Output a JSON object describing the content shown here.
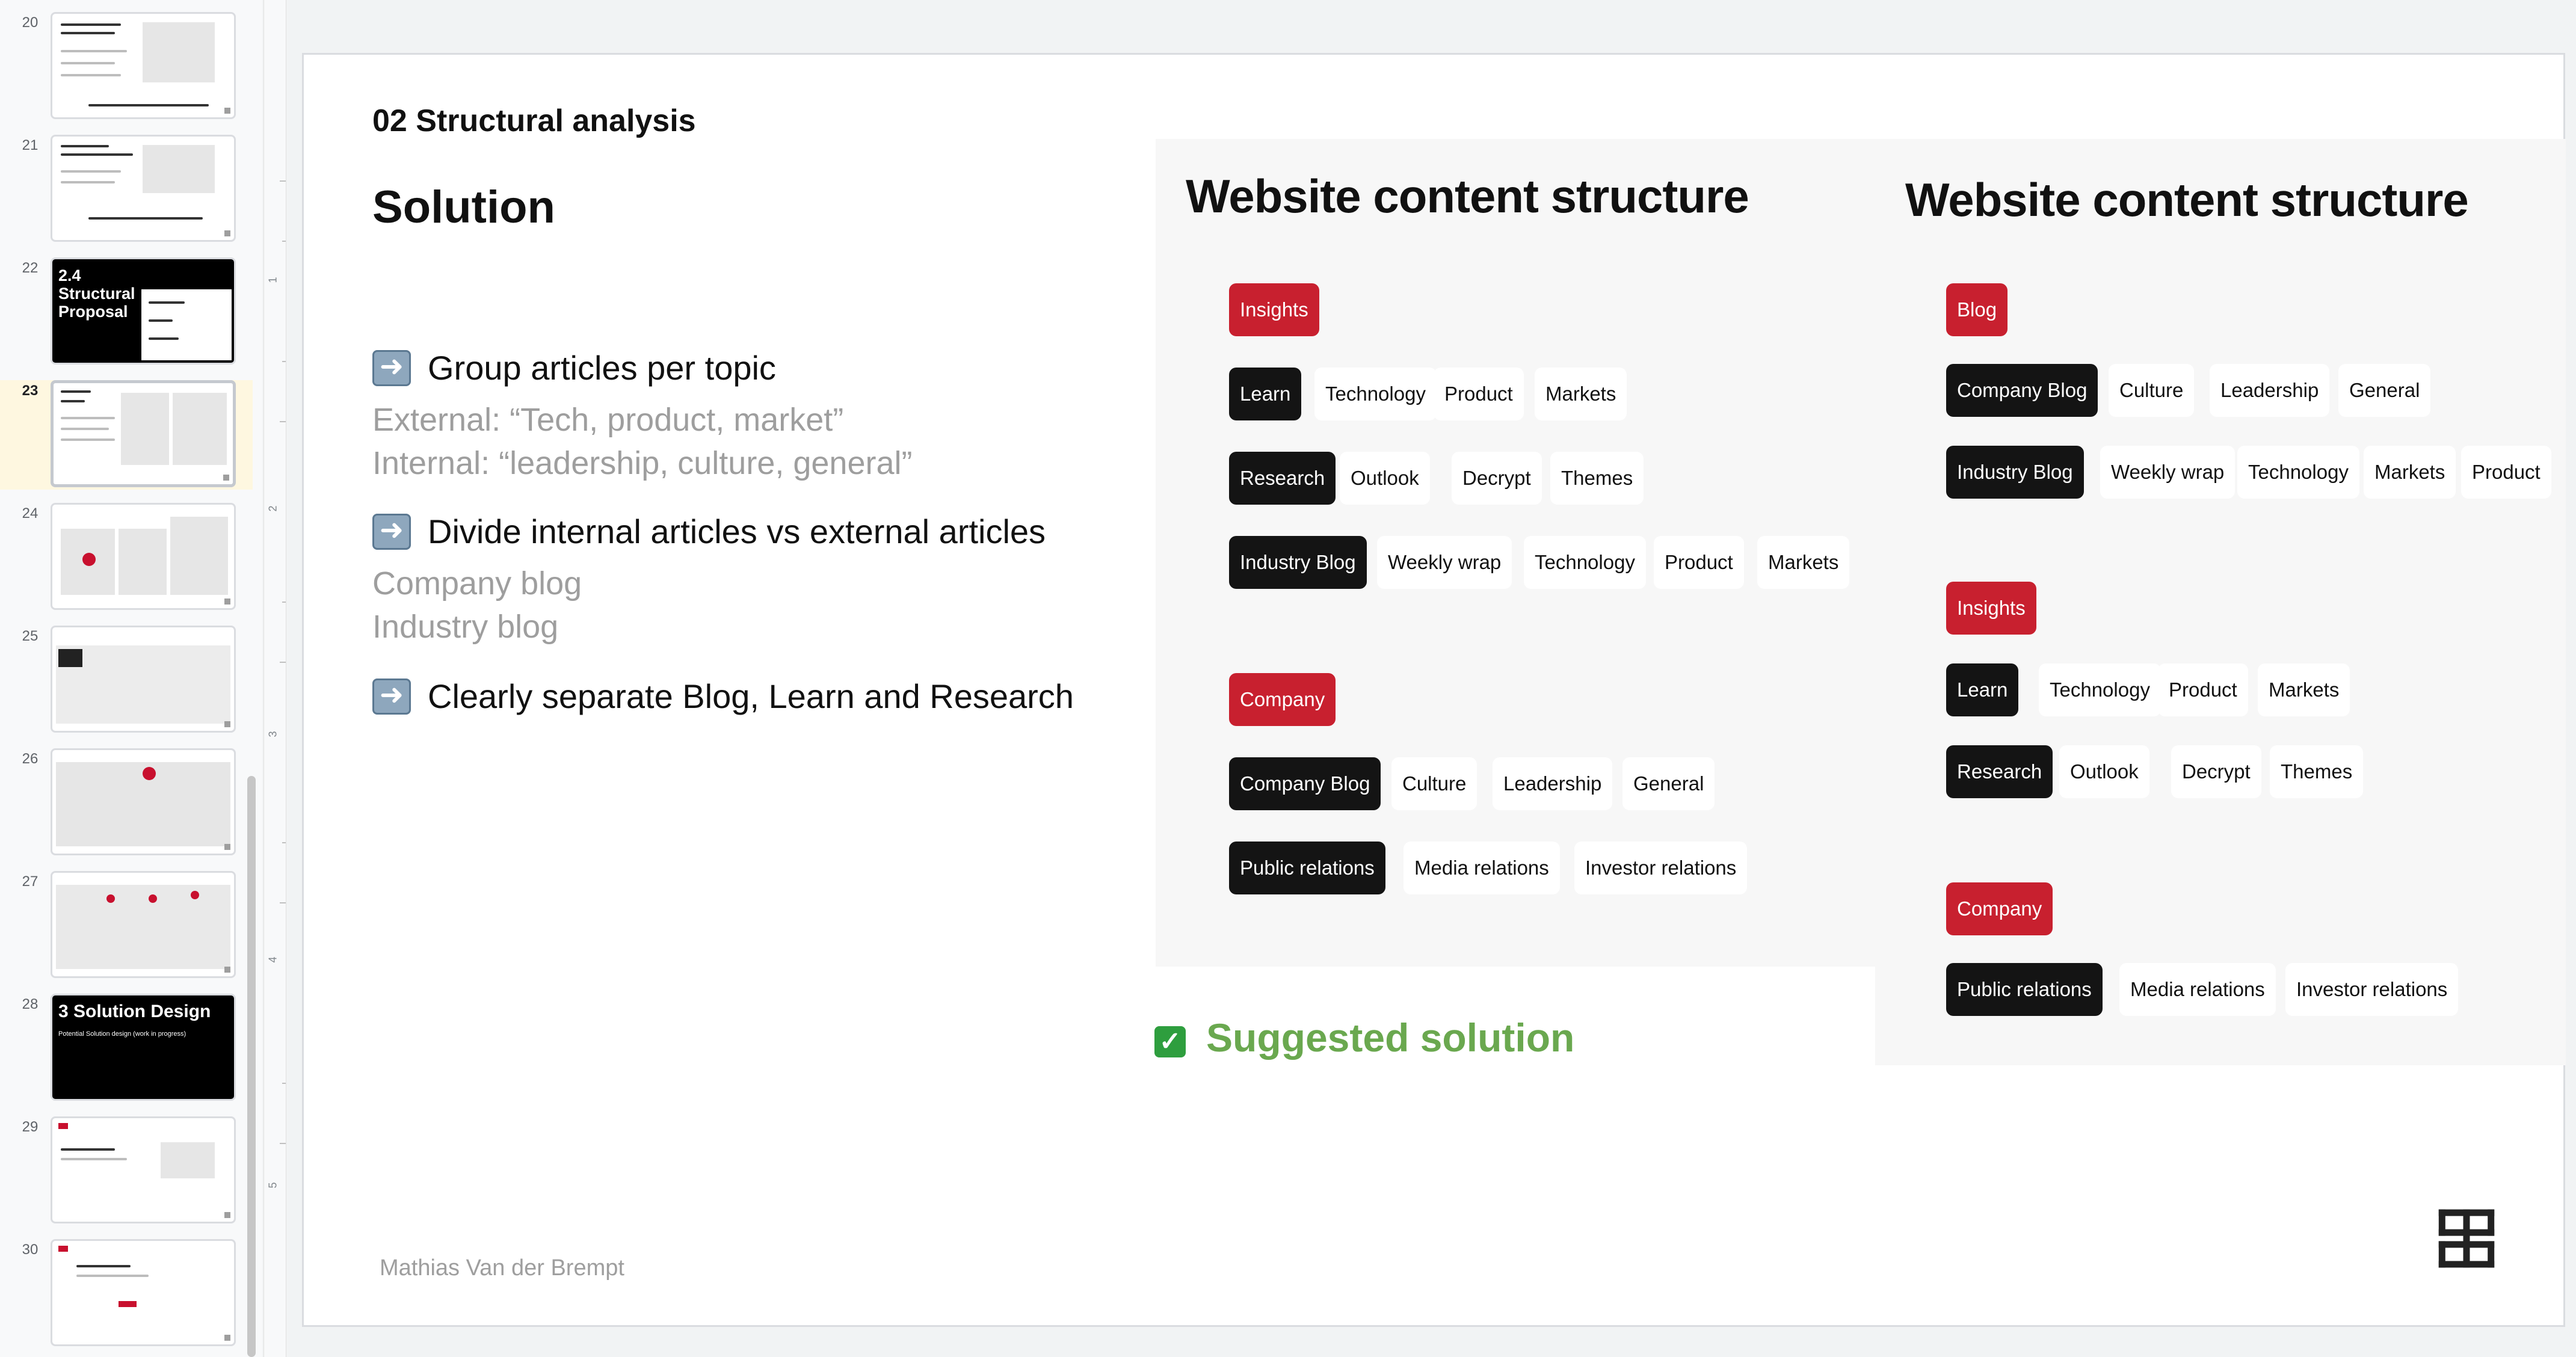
{
  "filmstrip": {
    "slides": [
      {
        "num": "20"
      },
      {
        "num": "21"
      },
      {
        "num": "22",
        "title": "2.4 Structural Proposal"
      },
      {
        "num": "23"
      },
      {
        "num": "24"
      },
      {
        "num": "25"
      },
      {
        "num": "26"
      },
      {
        "num": "27"
      },
      {
        "num": "28",
        "title": "3 Solution Design",
        "subtitle": "Potential Solution design (work in progress)"
      },
      {
        "num": "29"
      },
      {
        "num": "30"
      }
    ],
    "active_slide": "23"
  },
  "ruler": {
    "labels": [
      "1",
      "2",
      "3",
      "4",
      "5"
    ]
  },
  "slide": {
    "section_title": "02 Structural analysis",
    "heading": "Solution",
    "bullets": [
      {
        "icon": "right-arrow-icon",
        "text": "Group articles per topic",
        "details": [
          "External: “Tech, product, market”",
          "Internal: “leadership, culture, general”"
        ]
      },
      {
        "icon": "right-arrow-icon",
        "text": "Divide internal articles vs external articles",
        "details": [
          "Company blog",
          "Industry blog"
        ]
      },
      {
        "icon": "right-arrow-icon",
        "text": "Clearly separate Blog, Learn and Research",
        "details": []
      }
    ],
    "author": "Mathias Van der Brempt",
    "suggested": {
      "icon": "check-icon",
      "text": "Suggested solution",
      "color": "#6aa84f"
    },
    "left_panel": {
      "title": "Website content structure",
      "groups": [
        {
          "label": "Insights",
          "rows": [
            {
              "primary": "Learn",
              "items": [
                "Technology",
                "Product",
                "Markets"
              ]
            },
            {
              "primary": "Research",
              "items": [
                "Outlook",
                "Decrypt",
                "Themes"
              ]
            },
            {
              "primary": "Industry Blog",
              "items": [
                "Weekly wrap",
                "Technology",
                "Product",
                "Markets"
              ]
            }
          ]
        },
        {
          "label": "Company",
          "rows": [
            {
              "primary": "Company Blog",
              "items": [
                "Culture",
                "Leadership",
                "General"
              ]
            },
            {
              "primary": "Public relations",
              "items": [
                "Media relations",
                "Investor relations"
              ]
            }
          ]
        }
      ]
    },
    "right_panel": {
      "title": "Website content structure",
      "groups": [
        {
          "label": "Blog",
          "rows": [
            {
              "primary": "Company Blog",
              "items": [
                "Culture",
                "Leadership",
                "General"
              ]
            },
            {
              "primary": "Industry Blog",
              "items": [
                "Weekly wrap",
                "Technology",
                "Markets",
                "Product"
              ]
            }
          ]
        },
        {
          "label": "Insights",
          "rows": [
            {
              "primary": "Learn",
              "items": [
                "Technology",
                "Product",
                "Markets"
              ]
            },
            {
              "primary": "Research",
              "items": [
                "Outlook",
                "Decrypt",
                "Themes"
              ]
            }
          ]
        },
        {
          "label": "Company",
          "rows": [
            {
              "primary": "Public relations",
              "items": [
                "Media relations",
                "Investor relations"
              ]
            }
          ]
        }
      ]
    },
    "colors": {
      "red": "#c8202f",
      "dark": "#141414",
      "accent_green": "#6aa84f"
    }
  }
}
